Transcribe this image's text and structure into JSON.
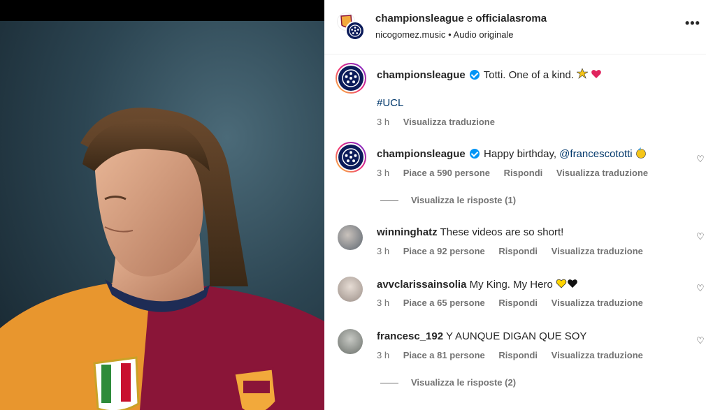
{
  "header": {
    "account_1": "championsleague",
    "conjunction": "e",
    "account_2": "officialasroma",
    "audio_author": "nicogomez.music",
    "separator": "•",
    "audio_label": "Audio originale",
    "more_icon": "more-horizontal-icon"
  },
  "caption": {
    "username": "championsleague",
    "text": "Totti. One of a kind.",
    "emojis": [
      "star-burst",
      "red-heart"
    ],
    "hashtag": "#UCL",
    "time": "3 h",
    "translate": "Visualizza traduzione"
  },
  "comments": [
    {
      "username": "championsleague",
      "verified": true,
      "text": "Happy birthday, ",
      "mention": "@francescototti",
      "time": "3 h",
      "likes": "Piace a 590 persone",
      "reply": "Rispondi",
      "translate": "Visualizza traduzione",
      "replies_label": "Visualizza le risposte (1)"
    },
    {
      "username": "winninghatz",
      "text": "These videos are so short!",
      "time": "3 h",
      "likes": "Piace a 92 persone",
      "reply": "Rispondi",
      "translate": "Visualizza traduzione"
    },
    {
      "username": "avvclarissainsolia",
      "text": "My King. My Hero",
      "time": "3 h",
      "likes": "Piace a 65 persone",
      "reply": "Rispondi",
      "translate": "Visualizza traduzione"
    },
    {
      "username": "francesc_192",
      "text": "Y AUNQUE DIGAN QUE SOY",
      "time": "3 h",
      "likes": "Piace a 81 persone",
      "reply": "Rispondi",
      "translate": "Visualizza traduzione",
      "replies_label": "Visualizza le risposte (2)"
    }
  ],
  "colors": {
    "ucl_navy": "#0b1b5a",
    "roma_maroon": "#8a1538",
    "roma_orange": "#f0a43a",
    "verified_blue": "#0095f6",
    "link": "#00376b",
    "muted": "#737373"
  }
}
